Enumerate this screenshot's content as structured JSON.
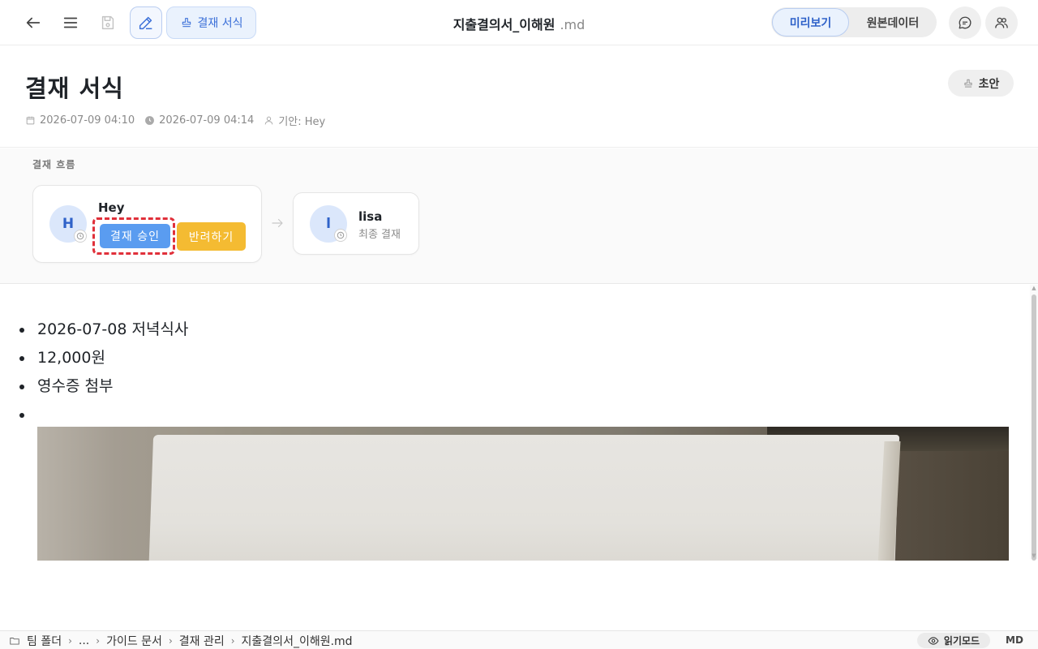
{
  "toolbar": {
    "form_button_label": "결재 서식",
    "doc_title": "지출결의서_이해원",
    "doc_ext": ".md",
    "view_preview": "미리보기",
    "view_raw": "원본데이터"
  },
  "header": {
    "title": "결재 서식",
    "draft_label": "초안",
    "created": "2026-07-09 04:10",
    "modified": "2026-07-09 04:14",
    "drafter": "기안: Hey"
  },
  "flow": {
    "label": "결재 흐름",
    "approvers": [
      {
        "initial": "H",
        "name": "Hey",
        "approve_label": "결재 승인",
        "reject_label": "반려하기"
      },
      {
        "initial": "l",
        "name": "lisa",
        "role": "최종 결재"
      }
    ]
  },
  "content": {
    "items": [
      "2026-07-08 저녁식사",
      "12,000원",
      "영수증 첨부",
      ""
    ]
  },
  "statusbar": {
    "breadcrumb": [
      "팀 폴더",
      "...",
      "가이드 문서",
      "결재 관리",
      "지출결의서_이해원.md"
    ],
    "reading_mode": "읽기모드",
    "format": "MD"
  },
  "colors": {
    "accent": "#2f62c9",
    "approve": "#5a9cf0",
    "reject": "#f4bb32",
    "highlight": "#e0303a"
  }
}
